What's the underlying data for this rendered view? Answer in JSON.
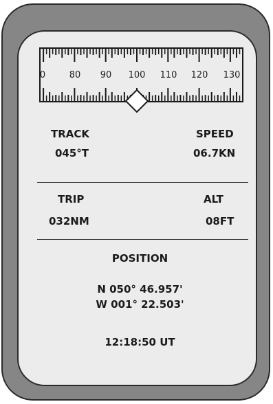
{
  "compass_scale": {
    "tick_labels": [
      "0",
      "80",
      "90",
      "100",
      "110",
      "120",
      "130"
    ],
    "pointer_value": 100
  },
  "track": {
    "label": "TRACK",
    "value": "045°T"
  },
  "speed": {
    "label": "SPEED",
    "value": "06.7KN"
  },
  "trip": {
    "label": "TRIP",
    "value": "032NM"
  },
  "alt": {
    "label": "ALT",
    "value": "08FT"
  },
  "position": {
    "label": "POSITION",
    "latitude": "N 050° 46.957'",
    "longitude": "W 001° 22.503'"
  },
  "time": {
    "value": "12:18:50 UT"
  },
  "colors": {
    "frame": "#868686",
    "screen": "#ececec",
    "ink": "#1a1a1a"
  }
}
